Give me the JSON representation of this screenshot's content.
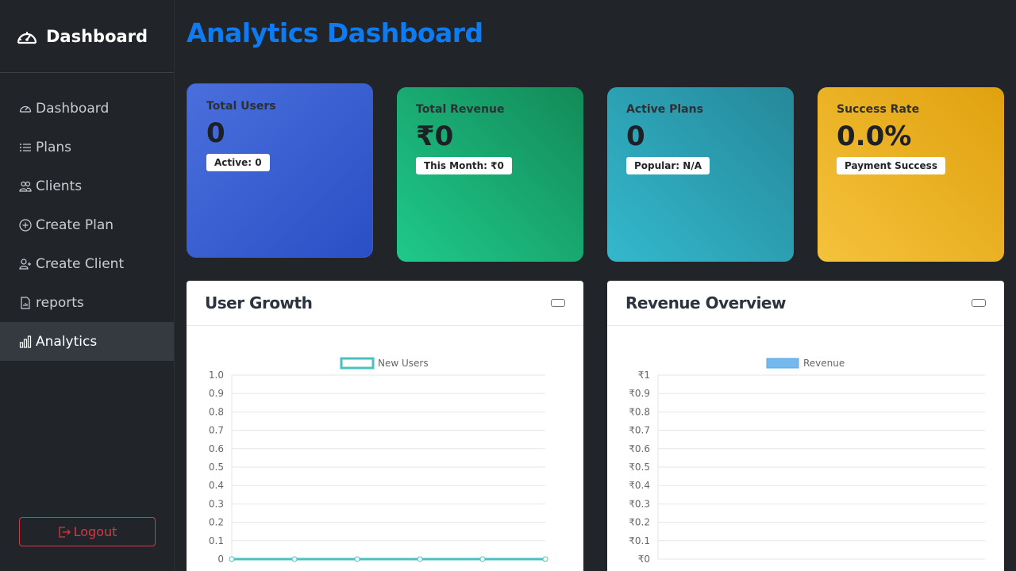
{
  "sidebar": {
    "brand": "Dashboard",
    "items": [
      {
        "label": "Dashboard",
        "icon": "speedometer-icon"
      },
      {
        "label": "Plans",
        "icon": "list-icon"
      },
      {
        "label": "Clients",
        "icon": "people-icon"
      },
      {
        "label": "Create Plan",
        "icon": "plus-circle-icon"
      },
      {
        "label": "Create Client",
        "icon": "person-add-icon"
      },
      {
        "label": "reports",
        "icon": "file-chart-icon"
      },
      {
        "label": "Analytics",
        "icon": "bar-chart-icon",
        "active": true
      }
    ],
    "logout": "Logout"
  },
  "page": {
    "title": "Analytics Dashboard"
  },
  "cards": {
    "users": {
      "label": "Total Users",
      "value": "0",
      "badge": "Active: 0"
    },
    "revenue": {
      "label": "Total Revenue",
      "value": "₹0",
      "badge": "This Month: ₹0"
    },
    "plans": {
      "label": "Active Plans",
      "value": "0",
      "badge": "Popular: N/A"
    },
    "success": {
      "label": "Success Rate",
      "value": "0.0%",
      "badge": "Payment Success"
    }
  },
  "colors": {
    "accent": "#0d7cf2",
    "users_card": "#3a5ac8",
    "revenue_card": "#1aa872",
    "plans_card": "#2ea0b3",
    "success_card": "#eab128",
    "logout": "#dc3545",
    "line_series": "#4bc0c0",
    "bar_series": "#74b9ee"
  },
  "chart_data": [
    {
      "type": "line",
      "title": "User Growth",
      "series": [
        {
          "name": "New Users",
          "values": [
            0,
            0,
            0,
            0,
            0,
            0
          ]
        }
      ],
      "x": [
        "",
        "",
        "",
        "",
        "",
        ""
      ],
      "yticks": [
        "1.0",
        "0.9",
        "0.8",
        "0.7",
        "0.6",
        "0.5",
        "0.4",
        "0.3",
        "0.2",
        "0.1",
        "0"
      ],
      "ylim": [
        0,
        1
      ],
      "grid": true,
      "legend": "top-center"
    },
    {
      "type": "bar",
      "title": "Revenue Overview",
      "series": [
        {
          "name": "Revenue",
          "values": []
        }
      ],
      "categories": [],
      "yticks": [
        "₹1",
        "₹0.9",
        "₹0.8",
        "₹0.7",
        "₹0.6",
        "₹0.5",
        "₹0.4",
        "₹0.3",
        "₹0.2",
        "₹0.1",
        "₹0"
      ],
      "ylim": [
        0,
        1
      ],
      "grid": true,
      "legend": "top-center"
    }
  ]
}
